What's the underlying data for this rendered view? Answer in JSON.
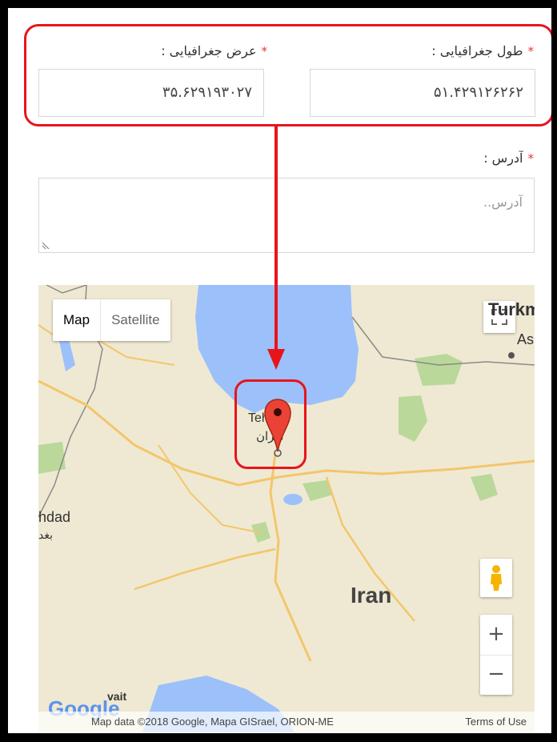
{
  "form": {
    "longitude_label": "طول جغرافیایی :",
    "longitude_value": "۵۱.۴۲۹۱۲۶۲۶۲",
    "latitude_label": "عرض جغرافیایی :",
    "latitude_value": "۳۵.۶۲۹۱۹۳۰۲۷",
    "address_label": "آدرس :",
    "address_placeholder": "آدرس..",
    "required_mark": "*"
  },
  "map": {
    "type_map": "Map",
    "type_satellite": "Satellite",
    "labels": {
      "iran": "Iran",
      "tehran_en": "Tehran",
      "tehran_fa": "تهران",
      "baghdad_en": "hdad",
      "baghdad_fa": "بغد",
      "turkmen": "Turkme",
      "ashgabat": "As",
      "kuwait": "vait"
    },
    "zoom_in": "+",
    "zoom_out": "−",
    "google_logo": "Google",
    "attribution": "Map data ©2018 Google, Mapa GISrael, ORION-ME",
    "terms": "Terms of Use"
  },
  "colors": {
    "annotation_red": "#e8141c",
    "required_star": "#e53935",
    "water": "#9cc0f9",
    "land": "#efe9d3",
    "road": "#f3c66a"
  }
}
